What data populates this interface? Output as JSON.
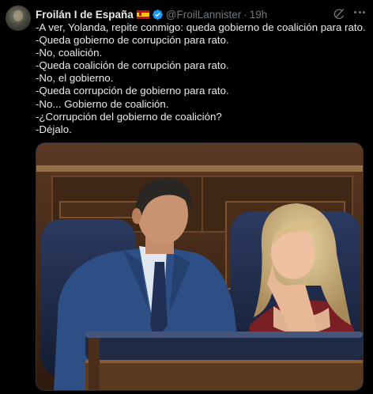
{
  "author": {
    "name": "Froilán I de España",
    "handle": "@FroilLannister",
    "time": "19h",
    "separator": "·",
    "flag_icon": "spain-flag-icon",
    "verified_icon": "verified-badge-icon",
    "verified_color": "#1d9bf0"
  },
  "actions": {
    "grok_icon": "grok-icon",
    "more_icon": "more-options-icon"
  },
  "tweet": {
    "lines": [
      "-A ver, Yolanda, repite conmigo: queda gobierno de coalición para rato.",
      "-Queda gobierno de corrupción para rato.",
      "-No, coalición.",
      "-Queda coalición de corrupción para rato.",
      "-No, el gobierno.",
      "-Queda corrupción de gobierno para rato.",
      "-No... Gobierno de coalición.",
      "-¿Corrupción del gobierno de coalición?",
      "-Déjalo."
    ]
  },
  "colors": {
    "background": "#000000",
    "text": "#e7e9ea",
    "secondary": "#71767b"
  }
}
